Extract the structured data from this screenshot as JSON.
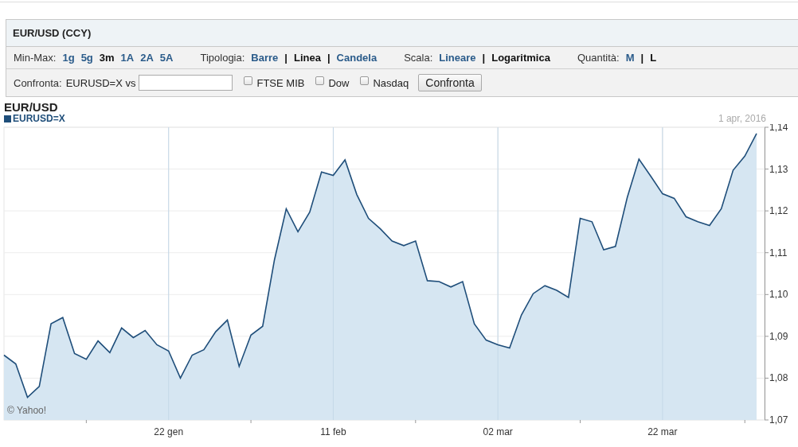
{
  "panel": {
    "title": "EUR/USD (CCY)",
    "groups": [
      {
        "label": "Min-Max:",
        "options": [
          {
            "label": "1g",
            "selected": false
          },
          {
            "label": "5g",
            "selected": false
          },
          {
            "label": "3m",
            "selected": true
          },
          {
            "label": "1A",
            "selected": false
          },
          {
            "label": "2A",
            "selected": false
          },
          {
            "label": "5A",
            "selected": false
          }
        ]
      },
      {
        "label": "Tipologia:",
        "separator": "|",
        "options": [
          {
            "label": "Barre",
            "selected": false
          },
          {
            "label": "Linea",
            "selected": true
          },
          {
            "label": "Candela",
            "selected": false
          }
        ]
      },
      {
        "label": "Scala:",
        "separator": "|",
        "options": [
          {
            "label": "Lineare",
            "selected": false
          },
          {
            "label": "Logaritmica",
            "selected": true
          }
        ]
      },
      {
        "label": "Quantità:",
        "separator": "|",
        "options": [
          {
            "label": "M",
            "selected": false
          },
          {
            "label": "L",
            "selected": true
          }
        ]
      }
    ],
    "compare": {
      "label": "Confronta:",
      "symbol": "EURUSD=X vs",
      "checkboxes": [
        {
          "label": "FTSE MIB",
          "checked": false
        },
        {
          "label": "Dow",
          "checked": false
        },
        {
          "label": "Nasdaq",
          "checked": false
        }
      ],
      "button": "Confronta"
    }
  },
  "chart": {
    "date": "1 apr, 2016",
    "credit": "© Yahoo!",
    "chart_data": {
      "type": "area",
      "title": "EUR/USD",
      "grid": true,
      "categories": [
        null,
        null,
        null,
        null,
        null,
        null,
        null,
        null,
        null,
        null,
        null,
        null,
        null,
        null,
        "22 gen",
        null,
        null,
        null,
        null,
        null,
        null,
        null,
        null,
        null,
        null,
        null,
        null,
        null,
        "11 feb",
        null,
        null,
        null,
        null,
        null,
        null,
        null,
        null,
        null,
        null,
        null,
        null,
        null,
        "02 mar",
        null,
        null,
        null,
        null,
        null,
        null,
        null,
        null,
        null,
        null,
        null,
        null,
        null,
        "22 mar",
        null,
        null,
        null,
        null,
        null,
        null,
        null,
        null
      ],
      "series": [
        {
          "name": "EURUSD=X",
          "color": "#1f4e7a",
          "values": [
            1.0855,
            1.0834,
            1.0754,
            1.078,
            1.093,
            1.0945,
            1.0859,
            1.0845,
            1.0889,
            1.0861,
            1.092,
            1.0897,
            1.0914,
            1.088,
            1.0865,
            1.08,
            1.0855,
            1.0868,
            1.0911,
            1.0939,
            1.0828,
            1.0903,
            1.0924,
            1.1083,
            1.1205,
            1.115,
            1.1197,
            1.1293,
            1.1285,
            1.1322,
            1.1239,
            1.1182,
            1.1157,
            1.1128,
            1.1117,
            1.1128,
            1.1033,
            1.1031,
            1.1018,
            1.1031,
            1.093,
            1.0891,
            1.088,
            1.0872,
            1.0951,
            1.1002,
            1.1021,
            1.101,
            1.0993,
            1.1182,
            1.1174,
            1.1107,
            1.1115,
            1.1232,
            1.1324,
            1.1283,
            1.1241,
            1.123,
            1.1186,
            1.1174,
            1.1165,
            1.1205,
            1.1297,
            1.1331,
            1.1385
          ]
        }
      ],
      "ylim": [
        1.07,
        1.14
      ],
      "yticks": [
        {
          "value": 1.07,
          "label": "1,07"
        },
        {
          "value": 1.08,
          "label": "1,08"
        },
        {
          "value": 1.09,
          "label": "1,09"
        },
        {
          "value": 1.1,
          "label": "1,10"
        },
        {
          "value": 1.11,
          "label": "1,11"
        },
        {
          "value": 1.12,
          "label": "1,12"
        },
        {
          "value": 1.13,
          "label": "1,13"
        },
        {
          "value": 1.14,
          "label": "1,14"
        }
      ]
    }
  }
}
